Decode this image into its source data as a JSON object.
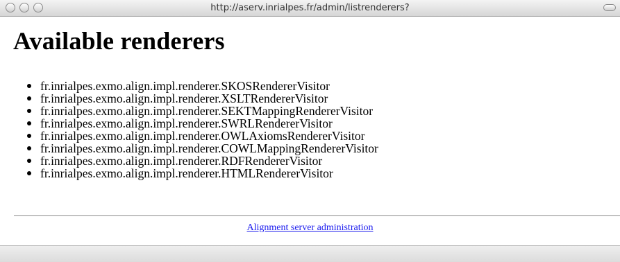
{
  "window": {
    "url": "http://aserv.inrialpes.fr/admin/listrenderers?"
  },
  "page": {
    "heading": "Available renderers",
    "renderers": [
      "fr.inrialpes.exmo.align.impl.renderer.SKOSRendererVisitor",
      "fr.inrialpes.exmo.align.impl.renderer.XSLTRendererVisitor",
      "fr.inrialpes.exmo.align.impl.renderer.SEKTMappingRendererVisitor",
      "fr.inrialpes.exmo.align.impl.renderer.SWRLRendererVisitor",
      "fr.inrialpes.exmo.align.impl.renderer.OWLAxiomsRendererVisitor",
      "fr.inrialpes.exmo.align.impl.renderer.COWLMappingRendererVisitor",
      "fr.inrialpes.exmo.align.impl.renderer.RDFRendererVisitor",
      "fr.inrialpes.exmo.align.impl.renderer.HTMLRendererVisitor"
    ],
    "footer_link": "Alignment server administration"
  }
}
